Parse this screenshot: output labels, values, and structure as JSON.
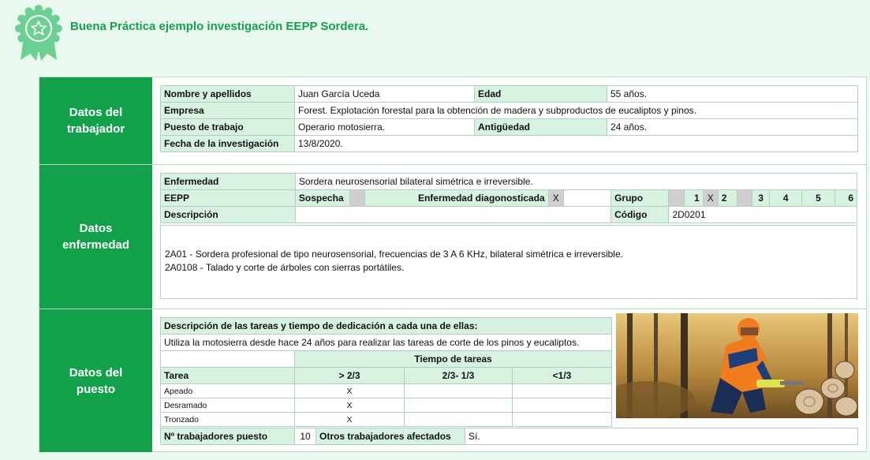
{
  "page": {
    "title": "Buena Práctica ejemplo investigación EEPP Sordera."
  },
  "badge": {
    "icon": "star-medal-icon",
    "color": "#6ccf93"
  },
  "colors": {
    "accent": "#12a04a",
    "header_fill": "#d7f2e1",
    "background": "#e9f9ef"
  },
  "worker": {
    "section_label": "Datos del\ntrabajador",
    "name_label": "Nombre y apellidos",
    "name": "Juan García Uceda",
    "age_label": "Edad",
    "age": "55 años.",
    "company_label": "Empresa",
    "company": "Forest.  Explotación forestal para la obtención de madera y subproductos de eucaliptos y pinos.",
    "job_label": "Puesto de trabajo",
    "job": "Operario motosierra.",
    "seniority_label": "Antigüedad",
    "seniority": "24 años.",
    "date_label": "Fecha de la investigación",
    "date": "13/8/2020."
  },
  "disease": {
    "section_label": "Datos\nenfermedad",
    "disease_label": "Enfermedad",
    "disease": "Sordera neurosensorial bilateral simétrica e irreversible.",
    "eepp_label": "EEPP",
    "suspicion_label": "Sospecha",
    "suspicion_mark": "",
    "diagnosed_label": "Enfermedad diagonosticada",
    "diagnosed_mark": "X",
    "group_label": "Grupo",
    "group_mark": "X",
    "groups": [
      "1",
      "2",
      "3",
      "4",
      "5",
      "6"
    ],
    "description_label": "Descripción",
    "code_label": "Código",
    "code": "2D0201",
    "description_lines": [
      "2A01 - Sordera profesional de tipo neurosensorial, frecuencias de 3 A 6 KHz, bilateral simétrica e irreversible.",
      "2A0108 - Talado y corte de árboles con sierras portátiles."
    ]
  },
  "job": {
    "section_label": "Datos del\npuesto",
    "tasks_heading": "Descripción de las tareas y tiempo de dedicación a cada una de ellas:",
    "tasks_text": "Utiliza la motosierra desde hace 24 años para realizar las tareas de corte de los pinos y eucaliptos.",
    "time_heading": "Tiempo de tareas",
    "task_col": "Tarea",
    "cols": [
      "> 2/3",
      "2/3- 1/3",
      "<1/3"
    ],
    "rows": [
      {
        "task": "Apeado",
        "marks": [
          "X",
          "",
          ""
        ]
      },
      {
        "task": "Desramado",
        "marks": [
          "X",
          "",
          ""
        ]
      },
      {
        "task": "Tronzado",
        "marks": [
          "X",
          "",
          ""
        ]
      }
    ],
    "workers_label": "Nº trabajadores puesto",
    "workers": "10",
    "others_label": "Otros trabajadores afectados",
    "others": "Sí.",
    "photo": "chainsaw-worker-photo"
  }
}
